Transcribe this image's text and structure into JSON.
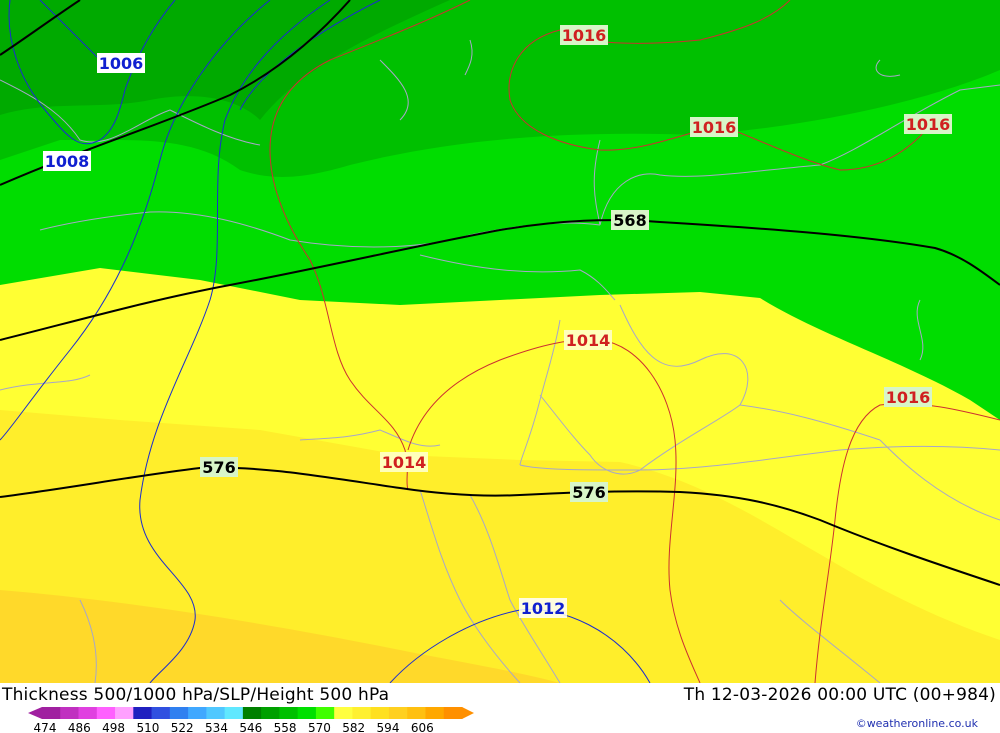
{
  "header": {
    "title": "Thickness 500/1000 hPa/SLP/Height 500 hPa",
    "datetime": "Th 12-03-2026 00:00 UTC (00+984)"
  },
  "credit": "©weatheronline.co.uk",
  "legend": {
    "ticks": [
      "474",
      "486",
      "498",
      "510",
      "522",
      "534",
      "546",
      "558",
      "570",
      "582",
      "594",
      "606"
    ],
    "colors": [
      "#a020a0",
      "#c030c0",
      "#e040e0",
      "#ff60ff",
      "#ffa0ff",
      "#2020c0",
      "#3050e0",
      "#3080f0",
      "#40a8ff",
      "#50c8ff",
      "#60e8ff",
      "#008000",
      "#00a000",
      "#00c000",
      "#00e000",
      "#40ff00",
      "#ffff40",
      "#fff030",
      "#ffe020",
      "#ffd020",
      "#ffc010",
      "#ffa800",
      "#ff9000"
    ]
  },
  "height_contours": [
    {
      "label": "568"
    },
    {
      "label": "576"
    },
    {
      "label": "576"
    }
  ],
  "pressure_labels": [
    {
      "label": "1006",
      "color": "#1020d0"
    },
    {
      "label": "1008",
      "color": "#1020d0"
    },
    {
      "label": "1012",
      "color": "#1020d0"
    },
    {
      "label": "1014",
      "color": "#d02020"
    },
    {
      "label": "1014",
      "color": "#d02020"
    },
    {
      "label": "1016",
      "color": "#d02020"
    },
    {
      "label": "1016",
      "color": "#d02020"
    },
    {
      "label": "1016",
      "color": "#d02020"
    },
    {
      "label": "1016",
      "color": "#d02020"
    }
  ]
}
